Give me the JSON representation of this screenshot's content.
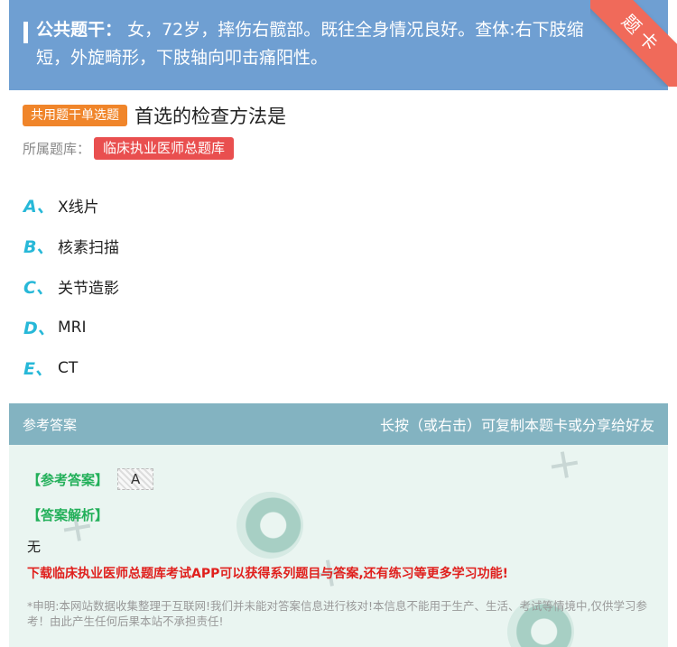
{
  "stem": {
    "label": "公共题干：",
    "text": "女，72岁，摔伤右髋部。既往全身情况良好。查体:右下肢缩短，外旋畸形，下肢轴向叩击痛阳性。"
  },
  "corner": {
    "label": "题卡"
  },
  "question": {
    "type_tag": "共用题干单选题",
    "title": "首选的检查方法是",
    "bank_label": "所属题库：",
    "bank_name": "临床执业医师总题库"
  },
  "options": [
    {
      "letter": "A、",
      "text": "X线片"
    },
    {
      "letter": "B、",
      "text": "核素扫描"
    },
    {
      "letter": "C、",
      "text": "关节造影"
    },
    {
      "letter": "D、",
      "text": "MRI"
    },
    {
      "letter": "E、",
      "text": "CT"
    }
  ],
  "answer_section": {
    "header_left": "参考答案",
    "header_right": "长按（或右击）可复制本题卡或分享给好友",
    "answer_label": "【参考答案】",
    "answer_value": "A",
    "analysis_label": "【答案解析】",
    "analysis_text": "无",
    "promo": "下载临床执业医师总题库考试APP可以获得系列题目与答案,还有练习等更多学习功能!",
    "disclaimer": "*申明:本网站数据收集整理于互联网!我们并未能对答案信息进行核对!本信息不能用于生产、生活、考试等情境中,仅供学习参考！由此产生任何后果本站不承担责任!"
  },
  "colors": {
    "stem_bg": "#6f9fd2",
    "tag_orange": "#f0852a",
    "tag_red": "#e94f4f",
    "option_letter": "#27b8d8",
    "answer_header": "#83b3c1",
    "answer_green": "#23b05a",
    "promo_red": "#e0201d"
  }
}
